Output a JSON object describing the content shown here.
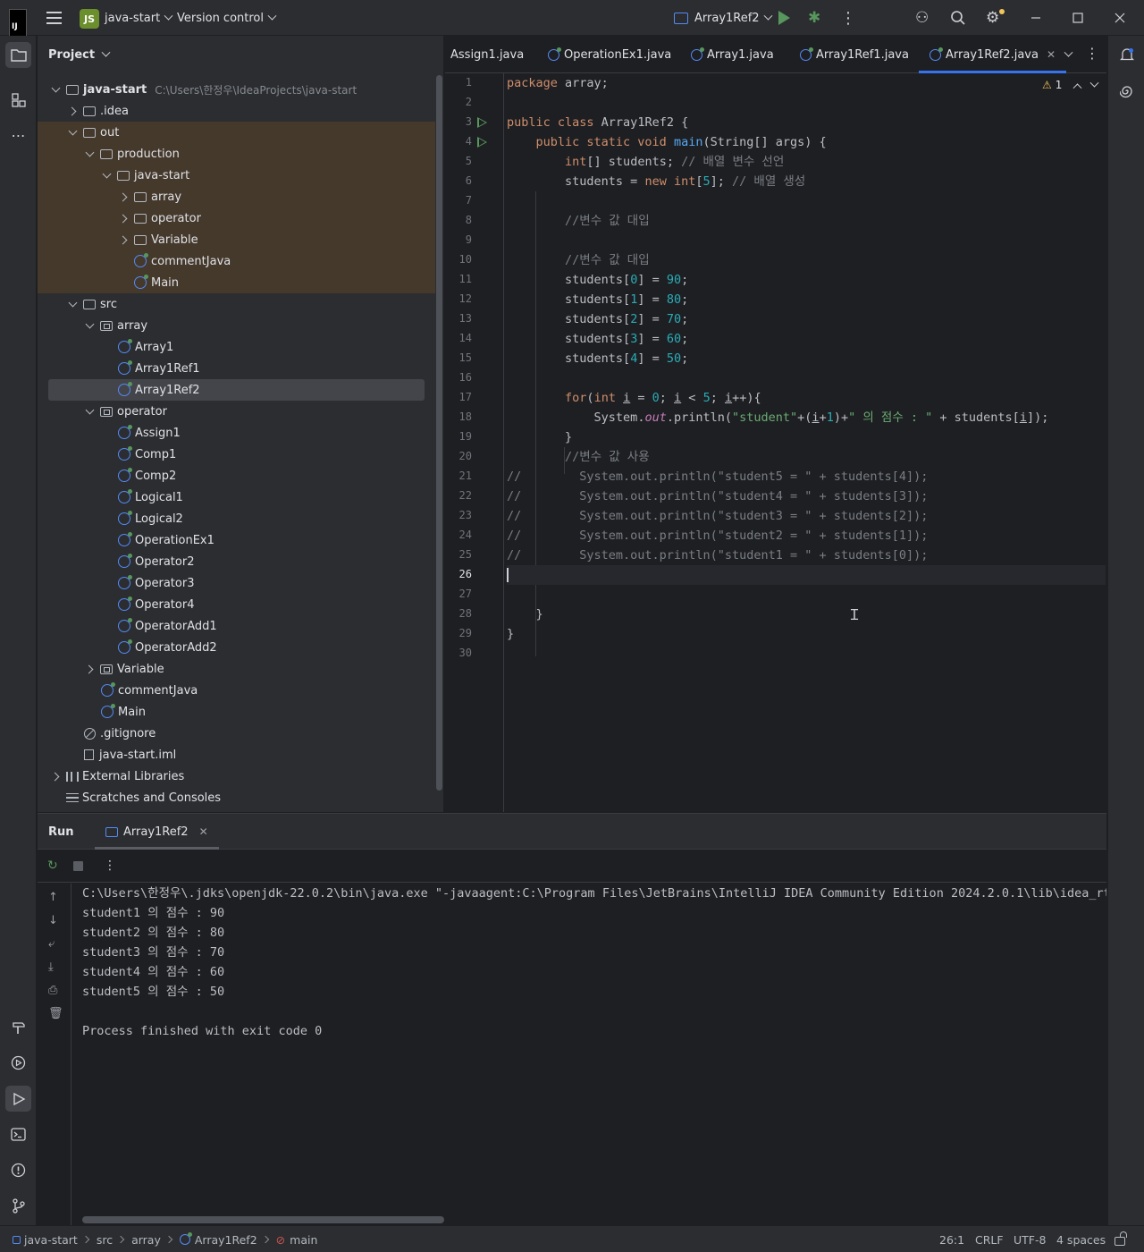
{
  "titlebar": {
    "project_badge": "JS",
    "project_name": "java-start",
    "version_control": "Version control",
    "run_config": "Array1Ref2"
  },
  "project_panel": {
    "title": "Project",
    "tree": [
      {
        "label": "java-start",
        "path": "C:\\Users\\한정우\\IdeaProjects\\java-start"
      },
      {
        "label": ".idea"
      },
      {
        "label": "out"
      },
      {
        "label": "production"
      },
      {
        "label": "java-start"
      },
      {
        "label": "array"
      },
      {
        "label": "operator"
      },
      {
        "label": "Variable"
      },
      {
        "label": "commentJava"
      },
      {
        "label": "Main"
      },
      {
        "label": "src"
      },
      {
        "label": "array"
      },
      {
        "label": "Array1"
      },
      {
        "label": "Array1Ref1"
      },
      {
        "label": "Array1Ref2"
      },
      {
        "label": "operator"
      },
      {
        "label": "Assign1"
      },
      {
        "label": "Comp1"
      },
      {
        "label": "Comp2"
      },
      {
        "label": "Logical1"
      },
      {
        "label": "Logical2"
      },
      {
        "label": "OperationEx1"
      },
      {
        "label": "Operator2"
      },
      {
        "label": "Operator3"
      },
      {
        "label": "Operator4"
      },
      {
        "label": "OperatorAdd1"
      },
      {
        "label": "OperatorAdd2"
      },
      {
        "label": "Variable"
      },
      {
        "label": "commentJava"
      },
      {
        "label": "Main"
      },
      {
        "label": ".gitignore"
      },
      {
        "label": "java-start.iml"
      },
      {
        "label": "External Libraries"
      },
      {
        "label": "Scratches and Consoles"
      }
    ]
  },
  "editor": {
    "tabs": [
      {
        "label": "Assign1.java"
      },
      {
        "label": "OperationEx1.java"
      },
      {
        "label": "Array1.java"
      },
      {
        "label": "Array1Ref1.java"
      },
      {
        "label": "Array1Ref2.java"
      }
    ],
    "close_glyph": "✕",
    "inspection_count": "1",
    "line_numbers": [
      "1",
      "2",
      "3",
      "4",
      "5",
      "6",
      "7",
      "8",
      "9",
      "10",
      "11",
      "12",
      "13",
      "14",
      "15",
      "16",
      "17",
      "18",
      "19",
      "20",
      "21",
      "22",
      "23",
      "24",
      "25",
      "26",
      "27",
      "28",
      "29",
      "30"
    ],
    "code": {
      "l1_kw": "package",
      "l1_rest": " array;",
      "l3_kw": "public class",
      "l3_rest": " Array1Ref2 {",
      "l4_kw": "public static void",
      "l4_fn": "main",
      "l4_rest": "(String[] args) {",
      "l5_kw": "int",
      "l5_rest": "[] students; ",
      "l5_cm": "// 배열 변수 선언",
      "l6_a": "students = ",
      "l6_kw": "new int",
      "l6_b": "[",
      "l6_num": "5",
      "l6_c": "]; ",
      "l6_cm": "// 배열 생성",
      "l8_cm": "//변수 값 대입",
      "l10_cm": "//변수 값 대입",
      "l11_a": "students[",
      "l11_i": "0",
      "l11_b": "] = ",
      "l11_v": "90",
      "l11_c": ";",
      "l12_a": "students[",
      "l12_i": "1",
      "l12_b": "] = ",
      "l12_v": "80",
      "l12_c": ";",
      "l13_a": "students[",
      "l13_i": "2",
      "l13_b": "] = ",
      "l13_v": "70",
      "l13_c": ";",
      "l14_a": "students[",
      "l14_i": "3",
      "l14_b": "] = ",
      "l14_v": "60",
      "l14_c": ";",
      "l15_a": "students[",
      "l15_i": "4",
      "l15_b": "] = ",
      "l15_v": "50",
      "l15_c": ";",
      "l17_kw": "for",
      "l17_a": "(",
      "l17_kw2": "int",
      "l17_b": " ",
      "l17_i1": "i",
      "l17_c": " = ",
      "l17_n0": "0",
      "l17_d": "; ",
      "l17_i2": "i",
      "l17_e": " < ",
      "l17_n5": "5",
      "l17_f": "; ",
      "l17_i3": "i",
      "l17_g": "++){",
      "l18_a": "System.",
      "l18_out": "out",
      "l18_b": ".println(",
      "l18_s1": "\"student\"",
      "l18_c": "+(",
      "l18_i": "i",
      "l18_d": "+",
      "l18_n": "1",
      "l18_e": ")+",
      "l18_s2": "\" 의 점수 : \"",
      "l18_f": " + students[",
      "l18_i2": "i",
      "l18_g": "]);",
      "l19": "}",
      "l20_cm": "//변수 값 사용",
      "l21_cm": "//        System.out.println(\"student5 = \" + students[4]);",
      "l22_cm": "//        System.out.println(\"student4 = \" + students[3]);",
      "l23_cm": "//        System.out.println(\"student3 = \" + students[2]);",
      "l24_cm": "//        System.out.println(\"student2 = \" + students[1]);",
      "l25_cm": "//        System.out.println(\"student1 = \" + students[0]);",
      "l28": "}",
      "l29": "}"
    }
  },
  "run_panel": {
    "title": "Run",
    "tab": "Array1Ref2",
    "console": [
      "C:\\Users\\한정우\\.jdks\\openjdk-22.0.2\\bin\\java.exe \"-javaagent:C:\\Program Files\\JetBrains\\IntelliJ IDEA Community Edition 2024.2.0.1\\lib\\idea_rt.jar",
      "student1 의 점수 : 90",
      "student2 의 점수 : 80",
      "student3 의 점수 : 70",
      "student4 의 점수 : 60",
      "student5 의 점수 : 50",
      "",
      "Process finished with exit code 0"
    ]
  },
  "statusbar": {
    "crumbs": [
      "java-start",
      "src",
      "array",
      "Array1Ref2",
      "main"
    ],
    "position": "26:1",
    "line_ending": "CRLF",
    "encoding": "UTF-8",
    "indent": "4 spaces"
  },
  "colors": {
    "accent": "#3574f0",
    "run_green": "#57965c",
    "excluded_bg": "#45392c"
  }
}
